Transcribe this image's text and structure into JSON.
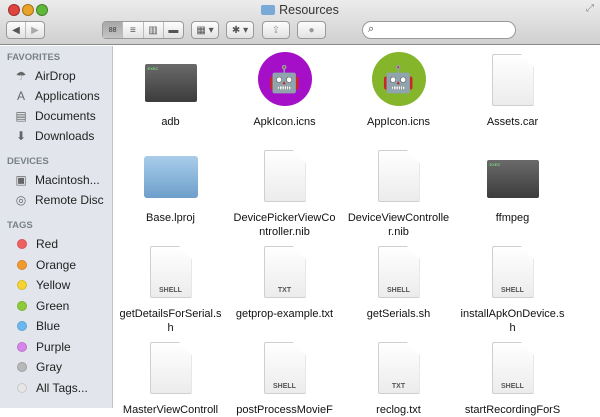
{
  "window": {
    "title": "Resources"
  },
  "toolbar": {
    "back": "◀",
    "forward": "▶",
    "views": [
      "88",
      "≡",
      "▥",
      "▬"
    ],
    "arrange": "▦ ▾",
    "action": "✱ ▾",
    "share": "⇪",
    "tags": "●"
  },
  "sidebar": {
    "favorites_header": "FAVORITES",
    "favorites": [
      {
        "label": "AirDrop",
        "icon": "☂"
      },
      {
        "label": "Applications",
        "icon": "A"
      },
      {
        "label": "Documents",
        "icon": "▤"
      },
      {
        "label": "Downloads",
        "icon": "⬇"
      }
    ],
    "devices_header": "DEVICES",
    "devices": [
      {
        "label": "Macintosh...",
        "icon": "▣"
      },
      {
        "label": "Remote Disc",
        "icon": "◎"
      }
    ],
    "tags_header": "TAGS",
    "tags": [
      {
        "label": "Red",
        "color": "#f06060"
      },
      {
        "label": "Orange",
        "color": "#f29a30"
      },
      {
        "label": "Yellow",
        "color": "#f5d330"
      },
      {
        "label": "Green",
        "color": "#8ccb3c"
      },
      {
        "label": "Blue",
        "color": "#6bb8f0"
      },
      {
        "label": "Purple",
        "color": "#d686ea"
      },
      {
        "label": "Gray",
        "color": "#b8b8b8"
      },
      {
        "label": "All Tags...",
        "color": "#e6e6e6"
      }
    ]
  },
  "files": [
    {
      "name": "adb",
      "kind": "term"
    },
    {
      "name": "ApkIcon.icns",
      "kind": "circle",
      "color": "#a60fc8",
      "glyph": "🤖"
    },
    {
      "name": "AppIcon.icns",
      "kind": "circle",
      "color": "#84b52a",
      "glyph": "🤖"
    },
    {
      "name": "Assets.car",
      "kind": "doc"
    },
    {
      "name": "Base.lproj",
      "kind": "folder"
    },
    {
      "name": "DevicePickerViewController.nib",
      "kind": "doc"
    },
    {
      "name": "DeviceViewController.nib",
      "kind": "doc"
    },
    {
      "name": "ffmpeg",
      "kind": "term"
    },
    {
      "name": "getDetailsForSerial.sh",
      "kind": "doc",
      "tag": "SHELL"
    },
    {
      "name": "getprop-example.txt",
      "kind": "doc",
      "tag": "TXT"
    },
    {
      "name": "getSerials.sh",
      "kind": "doc",
      "tag": "SHELL"
    },
    {
      "name": "installApkOnDevice.sh",
      "kind": "doc",
      "tag": "SHELL"
    },
    {
      "name": "MasterViewControll",
      "kind": "doc"
    },
    {
      "name": "postProcessMovieF",
      "kind": "doc",
      "tag": "SHELL"
    },
    {
      "name": "reclog.txt",
      "kind": "doc",
      "tag": "TXT"
    },
    {
      "name": "startRecordingForS",
      "kind": "doc",
      "tag": "SHELL"
    }
  ]
}
